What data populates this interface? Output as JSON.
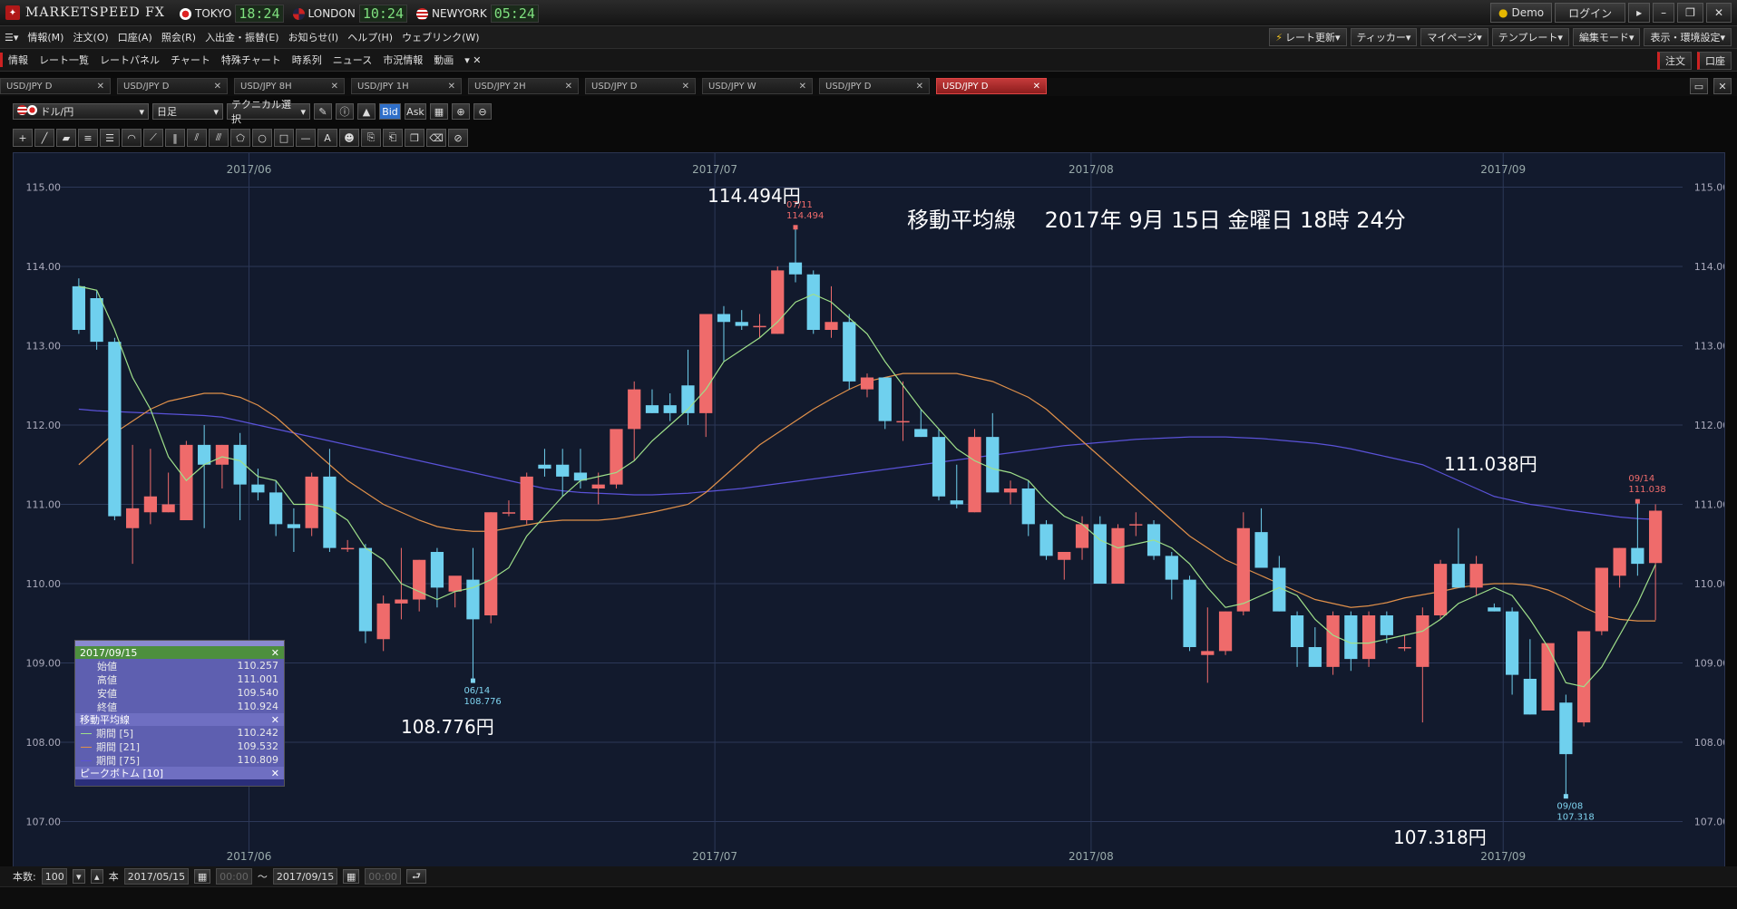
{
  "app": {
    "name": "MARKETSPEED FX"
  },
  "clocks": [
    {
      "city": "TOKYO",
      "time": "18:24"
    },
    {
      "city": "LONDON",
      "time": "10:24"
    },
    {
      "city": "NEWYORK",
      "time": "05:24"
    }
  ],
  "title_buttons": {
    "demo": "Demo",
    "login": "ログイン"
  },
  "menu": [
    "情報(M)",
    "注文(O)",
    "口座(A)",
    "照会(R)",
    "入出金・振替(E)",
    "お知らせ(I)",
    "ヘルプ(H)",
    "ウェブリンク(W)"
  ],
  "menu_right": [
    "レート更新",
    "ティッカー",
    "マイページ",
    "テンプレート",
    "編集モード",
    "表示・環境設定"
  ],
  "nav": [
    "情報",
    "レート一覧",
    "レートパネル",
    "チャート",
    "特殊チャート",
    "時系列",
    "ニュース",
    "市況情報",
    "動画"
  ],
  "nav_right": [
    "注文",
    "口座"
  ],
  "tabs": [
    "USD/JPY D",
    "USD/JPY D",
    "USD/JPY 8H",
    "USD/JPY 1H",
    "USD/JPY 2H",
    "USD/JPY D",
    "USD/JPY W",
    "USD/JPY D",
    "USD/JPY D"
  ],
  "active_tab": 8,
  "toolbar": {
    "pair": "ドル/円",
    "period": "日足",
    "technical": "テクニカル選択",
    "bid": "Bid",
    "ask": "Ask"
  },
  "chart_data": {
    "type": "candlestick",
    "title": "移動平均線　 2017年 9月 15日 金曜日 18時 24分",
    "x_month_labels": [
      "2017/06",
      "2017/07",
      "2017/08",
      "2017/09"
    ],
    "month_start_index": [
      10,
      36,
      57,
      80
    ],
    "ylim": [
      106.8,
      115.2
    ],
    "y_ticks": [
      "107.00",
      "108.00",
      "109.00",
      "110.00",
      "111.00",
      "112.00",
      "113.00",
      "114.00",
      "115.00"
    ],
    "up_color": "#ef6b6b",
    "down_color": "#6fd0ee",
    "candles": [
      [
        113.75,
        113.85,
        113.15,
        113.2
      ],
      [
        113.6,
        113.7,
        112.95,
        113.05
      ],
      [
        113.05,
        113.1,
        110.8,
        110.85
      ],
      [
        110.7,
        111.75,
        110.25,
        110.95
      ],
      [
        110.9,
        111.7,
        110.75,
        111.1
      ],
      [
        110.9,
        111.4,
        110.9,
        111.0
      ],
      [
        110.8,
        111.8,
        110.8,
        111.75
      ],
      [
        111.75,
        112.0,
        110.7,
        111.5
      ],
      [
        111.5,
        111.75,
        111.2,
        111.75
      ],
      [
        111.75,
        111.9,
        110.8,
        111.25
      ],
      [
        111.25,
        111.45,
        111.05,
        111.15
      ],
      [
        111.15,
        111.3,
        110.6,
        110.75
      ],
      [
        110.75,
        110.95,
        110.4,
        110.7
      ],
      [
        110.7,
        111.4,
        110.6,
        111.35
      ],
      [
        111.35,
        111.7,
        110.4,
        110.45
      ],
      [
        110.45,
        110.55,
        110.4,
        110.45
      ],
      [
        110.45,
        110.5,
        109.25,
        109.4
      ],
      [
        109.3,
        109.85,
        109.15,
        109.75
      ],
      [
        109.75,
        110.45,
        109.55,
        109.8
      ],
      [
        109.8,
        110.3,
        109.65,
        110.3
      ],
      [
        110.4,
        110.45,
        109.7,
        109.95
      ],
      [
        109.9,
        110.0,
        109.7,
        110.1
      ],
      [
        110.05,
        110.45,
        108.78,
        109.55
      ],
      [
        109.6,
        110.9,
        109.5,
        110.9
      ],
      [
        110.9,
        111.05,
        110.85,
        110.9
      ],
      [
        110.8,
        111.4,
        110.75,
        111.35
      ],
      [
        111.5,
        111.7,
        111.35,
        111.45
      ],
      [
        111.5,
        111.7,
        111.1,
        111.35
      ],
      [
        111.4,
        111.7,
        111.2,
        111.3
      ],
      [
        111.2,
        111.4,
        111.0,
        111.25
      ],
      [
        111.25,
        111.8,
        111.2,
        111.95
      ],
      [
        111.95,
        112.55,
        111.55,
        112.45
      ],
      [
        112.25,
        112.45,
        112.15,
        112.15
      ],
      [
        112.25,
        112.4,
        112.05,
        112.15
      ],
      [
        112.5,
        112.95,
        112.0,
        112.15
      ],
      [
        112.15,
        113.4,
        111.85,
        113.4
      ],
      [
        113.4,
        113.5,
        112.8,
        113.3
      ],
      [
        113.3,
        113.45,
        113.2,
        113.25
      ],
      [
        113.25,
        113.4,
        113.1,
        113.25
      ],
      [
        113.15,
        114.0,
        113.15,
        113.95
      ],
      [
        114.05,
        114.49,
        113.8,
        113.9
      ],
      [
        113.9,
        113.95,
        113.15,
        113.2
      ],
      [
        113.2,
        113.75,
        113.1,
        113.3
      ],
      [
        113.3,
        113.4,
        112.45,
        112.55
      ],
      [
        112.45,
        112.65,
        112.35,
        112.6
      ],
      [
        112.6,
        112.6,
        111.95,
        112.05
      ],
      [
        112.05,
        112.55,
        111.8,
        112.05
      ],
      [
        111.95,
        112.2,
        111.85,
        111.85
      ],
      [
        111.85,
        111.95,
        111.05,
        111.1
      ],
      [
        111.05,
        111.5,
        110.95,
        111.0
      ],
      [
        110.9,
        111.95,
        110.9,
        111.85
      ],
      [
        111.85,
        112.15,
        111.15,
        111.15
      ],
      [
        111.15,
        111.3,
        111.0,
        111.2
      ],
      [
        111.2,
        111.3,
        110.6,
        110.75
      ],
      [
        110.75,
        110.8,
        110.3,
        110.35
      ],
      [
        110.3,
        110.4,
        110.05,
        110.4
      ],
      [
        110.45,
        110.85,
        110.3,
        110.75
      ],
      [
        110.75,
        110.85,
        110.05,
        110.0
      ],
      [
        110.0,
        110.75,
        110.05,
        110.7
      ],
      [
        110.75,
        110.9,
        110.6,
        110.75
      ],
      [
        110.75,
        110.8,
        110.3,
        110.35
      ],
      [
        110.35,
        110.4,
        109.8,
        110.05
      ],
      [
        110.05,
        110.1,
        109.15,
        109.2
      ],
      [
        109.1,
        109.7,
        108.75,
        109.15
      ],
      [
        109.15,
        109.65,
        109.1,
        109.65
      ],
      [
        109.65,
        110.9,
        109.6,
        110.7
      ],
      [
        110.65,
        110.95,
        110.2,
        110.2
      ],
      [
        110.2,
        110.35,
        109.65,
        109.65
      ],
      [
        109.6,
        109.65,
        108.95,
        109.2
      ],
      [
        109.2,
        109.45,
        109.0,
        108.95
      ],
      [
        108.95,
        109.65,
        108.85,
        109.6
      ],
      [
        109.6,
        109.65,
        108.9,
        109.05
      ],
      [
        109.05,
        109.65,
        108.95,
        109.6
      ],
      [
        109.6,
        109.65,
        109.25,
        109.35
      ],
      [
        109.2,
        109.35,
        109.15,
        109.2
      ],
      [
        108.95,
        109.7,
        108.25,
        109.6
      ],
      [
        109.6,
        110.3,
        109.55,
        110.25
      ],
      [
        110.25,
        110.7,
        109.95,
        109.95
      ],
      [
        109.95,
        110.35,
        109.85,
        110.25
      ],
      [
        109.7,
        109.75,
        109.65,
        109.65
      ],
      [
        109.65,
        109.7,
        108.6,
        108.85
      ],
      [
        108.8,
        109.3,
        108.35,
        108.35
      ],
      [
        108.4,
        109.25,
        108.4,
        109.25
      ],
      [
        108.5,
        108.6,
        107.32,
        107.85
      ],
      [
        108.25,
        109.4,
        108.2,
        109.4
      ],
      [
        109.4,
        110.2,
        109.35,
        110.2
      ],
      [
        110.1,
        110.45,
        109.95,
        110.45
      ],
      [
        110.45,
        111.04,
        110.1,
        110.25
      ],
      [
        110.26,
        111.0,
        109.54,
        110.92
      ]
    ],
    "ma_colors": [
      "#9fe08a",
      "#e0904a",
      "#5a52d8"
    ],
    "ma5": [
      113.75,
      113.7,
      113.2,
      112.6,
      112.2,
      111.6,
      111.3,
      111.5,
      111.6,
      111.55,
      111.35,
      111.3,
      111.0,
      111.0,
      110.95,
      110.8,
      110.45,
      110.3,
      110.0,
      109.9,
      109.8,
      109.9,
      109.95,
      110.05,
      110.2,
      110.6,
      110.85,
      111.1,
      111.3,
      111.35,
      111.4,
      111.55,
      111.8,
      112.0,
      112.2,
      112.45,
      112.8,
      112.95,
      113.1,
      113.3,
      113.55,
      113.65,
      113.55,
      113.35,
      113.15,
      112.8,
      112.5,
      112.2,
      111.95,
      111.7,
      111.55,
      111.45,
      111.4,
      111.3,
      111.05,
      110.85,
      110.75,
      110.55,
      110.45,
      110.5,
      110.55,
      110.45,
      110.25,
      109.95,
      109.7,
      109.75,
      109.85,
      109.95,
      109.85,
      109.55,
      109.35,
      109.25,
      109.25,
      109.3,
      109.35,
      109.4,
      109.55,
      109.75,
      109.85,
      109.95,
      109.85,
      109.55,
      109.2,
      108.75,
      108.7,
      108.95,
      109.35,
      109.75,
      110.24
    ],
    "ma21": [
      111.5,
      111.7,
      111.9,
      112.05,
      112.2,
      112.3,
      112.35,
      112.4,
      112.4,
      112.35,
      112.25,
      112.1,
      111.9,
      111.7,
      111.5,
      111.3,
      111.15,
      111.0,
      110.9,
      110.8,
      110.72,
      110.68,
      110.66,
      110.66,
      110.7,
      110.74,
      110.78,
      110.8,
      110.8,
      110.8,
      110.82,
      110.86,
      110.9,
      110.95,
      111.0,
      111.15,
      111.35,
      111.55,
      111.75,
      111.9,
      112.05,
      112.2,
      112.33,
      112.45,
      112.55,
      112.6,
      112.65,
      112.65,
      112.65,
      112.65,
      112.6,
      112.55,
      112.45,
      112.35,
      112.2,
      112.0,
      111.8,
      111.6,
      111.4,
      111.2,
      111.0,
      110.8,
      110.6,
      110.45,
      110.3,
      110.2,
      110.1,
      110.0,
      109.9,
      109.8,
      109.75,
      109.7,
      109.72,
      109.76,
      109.82,
      109.86,
      109.9,
      109.95,
      109.98,
      110.0,
      110.0,
      109.98,
      109.92,
      109.82,
      109.7,
      109.6,
      109.55,
      109.53,
      109.53
    ],
    "ma75": [
      112.2,
      112.18,
      112.17,
      112.16,
      112.15,
      112.14,
      112.13,
      112.12,
      112.1,
      112.05,
      112.0,
      111.95,
      111.9,
      111.85,
      111.8,
      111.75,
      111.7,
      111.65,
      111.6,
      111.55,
      111.5,
      111.45,
      111.4,
      111.35,
      111.3,
      111.25,
      111.2,
      111.17,
      111.15,
      111.14,
      111.13,
      111.12,
      111.12,
      111.13,
      111.14,
      111.16,
      111.18,
      111.2,
      111.23,
      111.26,
      111.29,
      111.32,
      111.35,
      111.38,
      111.41,
      111.44,
      111.47,
      111.5,
      111.53,
      111.56,
      111.59,
      111.62,
      111.65,
      111.68,
      111.71,
      111.74,
      111.76,
      111.78,
      111.8,
      111.82,
      111.83,
      111.84,
      111.85,
      111.85,
      111.85,
      111.84,
      111.83,
      111.81,
      111.79,
      111.77,
      111.74,
      111.7,
      111.65,
      111.6,
      111.55,
      111.5,
      111.4,
      111.3,
      111.2,
      111.1,
      111.05,
      111.0,
      110.97,
      110.93,
      110.9,
      110.87,
      110.84,
      110.82,
      110.81
    ],
    "annotations": {
      "high_label": "114.494円",
      "high_date": "07/11",
      "high_value": "114.494",
      "low1_label": "108.776円",
      "low1_date": "06/14",
      "low1_value": "108.776",
      "low2_label": "107.318円",
      "low2_date": "09/08",
      "low2_value": "107.318",
      "recent_label": "111.038円",
      "recent_date": "09/14",
      "recent_value": "111.038"
    }
  },
  "info_panel": {
    "date": "2017/09/15",
    "ohlc": [
      {
        "label": "始値",
        "value": "110.257"
      },
      {
        "label": "高値",
        "value": "111.001"
      },
      {
        "label": "安値",
        "value": "109.540"
      },
      {
        "label": "終値",
        "value": "110.924"
      }
    ],
    "ma_title": "移動平均線",
    "ma_rows": [
      {
        "label": "期間 [5]",
        "value": "110.242"
      },
      {
        "label": "期間 [21]",
        "value": "109.532"
      },
      {
        "label": "期間 [75]",
        "value": "110.809"
      }
    ],
    "peak_title": "ピークボトム [10]"
  },
  "footer": {
    "count_label": "本数:",
    "count": "100",
    "unit": "本",
    "from": "2017/05/15",
    "to": "2017/09/15",
    "time_placeholder": "00:00",
    "tilde": "〜"
  }
}
